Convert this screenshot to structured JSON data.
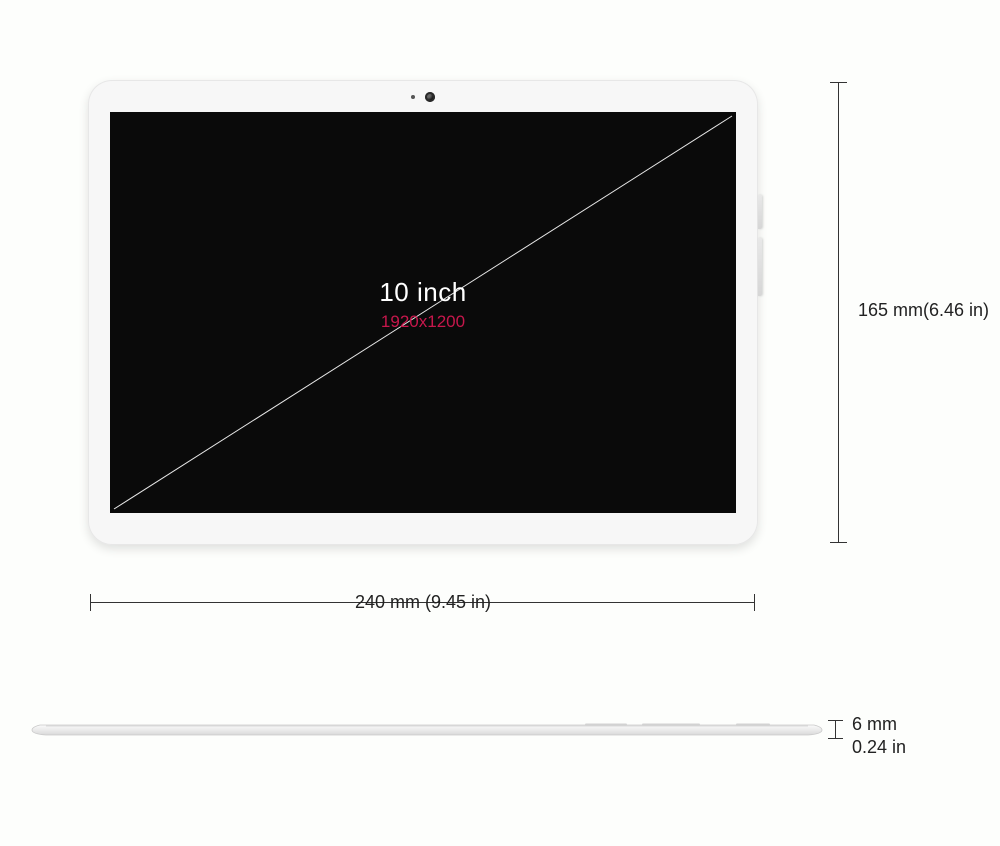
{
  "screen": {
    "diagonal_label": "10 inch",
    "resolution_label": "1920x1200"
  },
  "dimensions": {
    "height_label": "165 mm(6.46 in)",
    "width_label": "240 mm (9.45 in)",
    "thickness_mm": "6 mm",
    "thickness_in": "0.24 in"
  }
}
